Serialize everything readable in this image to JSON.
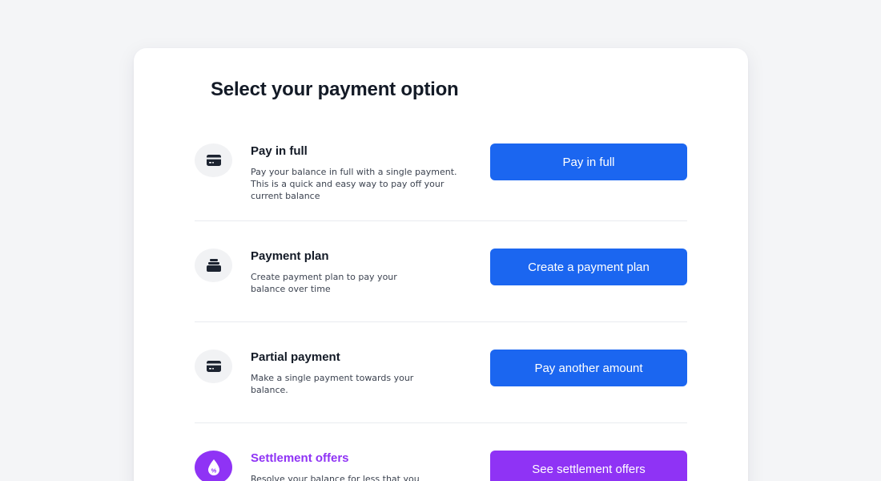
{
  "page": {
    "title": "Select your payment option"
  },
  "options": [
    {
      "title": "Pay in full",
      "description_lines": [
        "Pay your balance in full with a single payment.",
        "This is a quick and easy way to pay off your",
        "current balance"
      ],
      "button_label": "Pay in full",
      "icon": "credit-card-icon"
    },
    {
      "title": "Payment plan",
      "description_lines": [
        "Create payment plan to pay your",
        "balance over time"
      ],
      "button_label": "Create a payment plan",
      "icon": "stack-icon"
    },
    {
      "title": "Partial payment",
      "description_lines": [
        "Make a single payment towards your",
        "balance."
      ],
      "button_label": "Pay another amount",
      "icon": "credit-card-icon"
    },
    {
      "title": "Settlement offers",
      "description_lines": [
        "Resolve your balance for less that you"
      ],
      "button_label": "See settlement offers",
      "icon": "percent-drop-icon"
    }
  ],
  "colors": {
    "primary": "#1b66f0",
    "accent_purple": "#8f33f5",
    "text_dark": "#131a26",
    "icon_bg": "#f1f2f4"
  }
}
